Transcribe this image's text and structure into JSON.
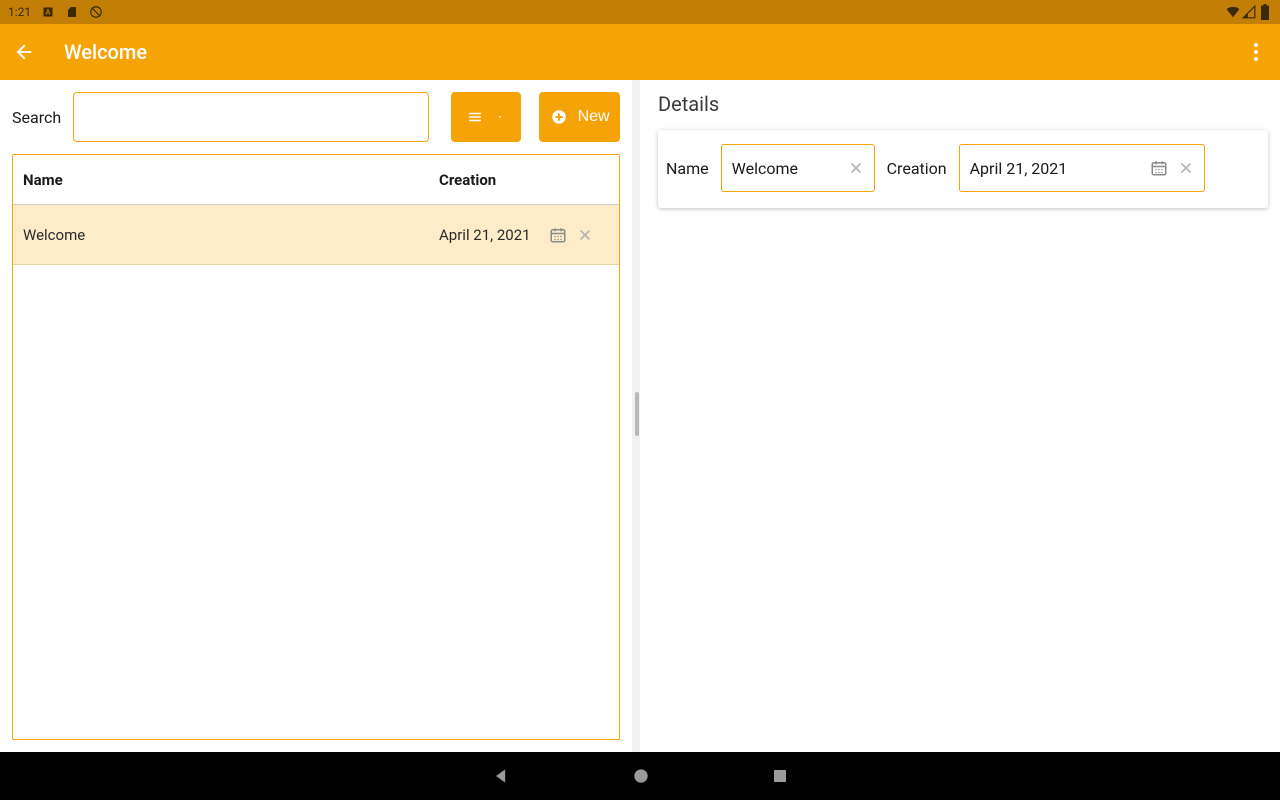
{
  "status": {
    "time": "1:21"
  },
  "header": {
    "title": "Welcome"
  },
  "search": {
    "label": "Search",
    "value": "",
    "newLabel": "New"
  },
  "table": {
    "headers": {
      "name": "Name",
      "creation": "Creation"
    },
    "rows": [
      {
        "name": "Welcome",
        "creation": "April 21, 2021"
      }
    ]
  },
  "details": {
    "title": "Details",
    "nameLabel": "Name",
    "nameValue": "Welcome",
    "creationLabel": "Creation",
    "creationValue": "April 21, 2021"
  },
  "colors": {
    "primary": "#f6a307",
    "statusBar": "#c27e06",
    "rowHighlight": "#fdecc7"
  }
}
